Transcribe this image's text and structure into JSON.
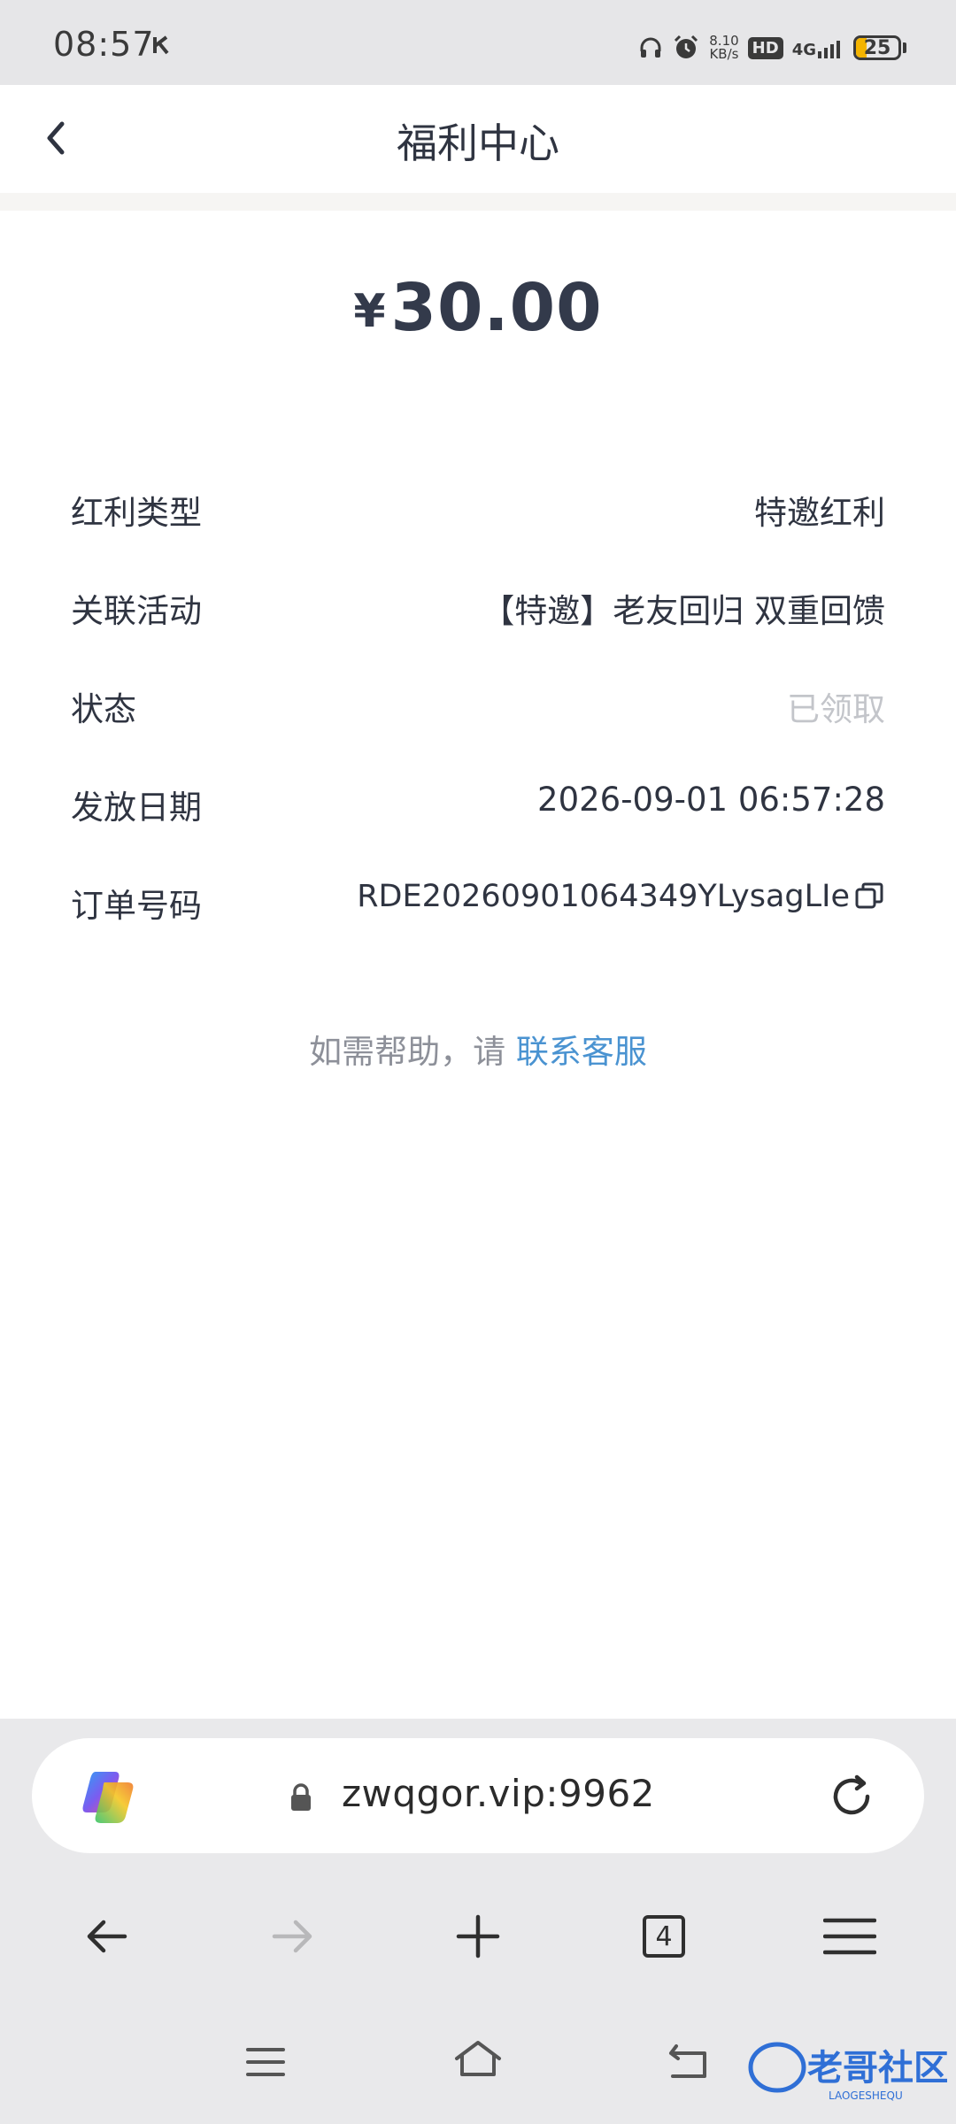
{
  "status_bar": {
    "time": "08:57",
    "speed_value": "8.10",
    "speed_unit": "KB/s",
    "hd": "HD",
    "network": "4G",
    "battery": "25",
    "battery_level_percent": 25
  },
  "header": {
    "title": "福利中心"
  },
  "amount": {
    "currency": "¥",
    "value": "30.00"
  },
  "details": [
    {
      "label": "红利类型",
      "value": "特邀红利"
    },
    {
      "label": "关联活动",
      "value": "【特邀】老友回归 双重回馈"
    },
    {
      "label": "状态",
      "value": "已领取"
    },
    {
      "label": "发放日期",
      "value": "2026-09-01 06:57:28"
    },
    {
      "label": "订单号码",
      "value": "RDE20260901064349YLysagLIe"
    }
  ],
  "help": {
    "prefix": "如需帮助，请 ",
    "link": "联系客服"
  },
  "browser": {
    "url": "zwqgor.vip:9962",
    "tab_count": "4"
  },
  "watermark": {
    "text": "老哥社区",
    "subtext": "LAOGESHEQU"
  },
  "colors": {
    "accent_link": "#4a93d1",
    "text_primary": "#2f3441",
    "text_muted": "#c3c5ca"
  }
}
